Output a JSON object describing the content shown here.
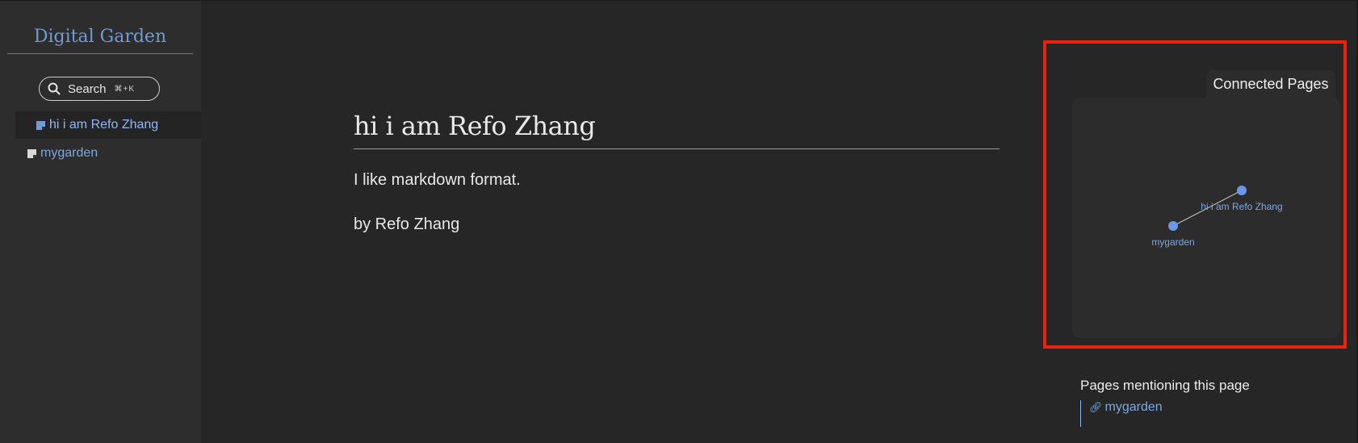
{
  "sidebar": {
    "site_title": "Digital Garden",
    "search": {
      "label": "Search",
      "shortcut": "⌘+K"
    },
    "items": [
      {
        "label": "hi i am Refo Zhang",
        "active": true
      },
      {
        "label": "mygarden",
        "active": false
      }
    ]
  },
  "main": {
    "title": "hi i am Refo Zhang",
    "paragraphs": [
      "I like markdown format.",
      "by Refo Zhang"
    ]
  },
  "graph": {
    "tab_label": "Connected Pages",
    "nodes": [
      {
        "label": "hi i am Refo Zhang"
      },
      {
        "label": "mygarden"
      }
    ],
    "colors": {
      "node": "#6b97e8",
      "edge": "#c8c8c8",
      "label": "#7aa7e6"
    }
  },
  "mentions": {
    "title": "Pages mentioning this page",
    "items": [
      {
        "label": "mygarden"
      }
    ]
  }
}
